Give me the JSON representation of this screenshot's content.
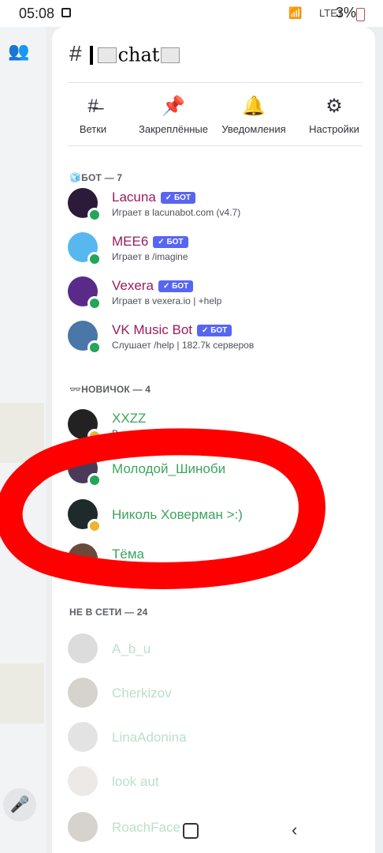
{
  "status_bar": {
    "time": "05:08",
    "network": "LTE1",
    "battery": "3%"
  },
  "channel": {
    "title": "chat"
  },
  "actions": [
    {
      "label": "Ветки",
      "icon": "threads-icon"
    },
    {
      "label": "Закреплённые",
      "icon": "pin-icon"
    },
    {
      "label": "Уведомления",
      "icon": "bell-icon"
    },
    {
      "label": "Настройки",
      "icon": "gear-icon"
    }
  ],
  "sections": {
    "bots": "БОТ — 7",
    "newbie": "НОВИЧОК — 4",
    "offline": "НЕ В СЕТИ — 24"
  },
  "bot_badge": "✓ БОТ",
  "bots": [
    {
      "name": "Lacuna",
      "status": "Играет в lacunabot.com (v4.7)",
      "avatar_color": "#2b1a3a"
    },
    {
      "name": "MEE6",
      "status": "Играет в /imagine",
      "avatar_color": "#57b8f0"
    },
    {
      "name": "Vexera",
      "status": "Играет в vexera.io | +help",
      "avatar_color": "#5a2a8a"
    },
    {
      "name": "VK Music Bot",
      "status": "Слушает /help | 182.7k серверов",
      "avatar_color": "#4a76a8"
    }
  ],
  "newbies": [
    {
      "name": "XXZZ",
      "status": "В отпуске с 13.06 по 24.06",
      "presence": "idle",
      "avatar_color": "#222222"
    },
    {
      "name": "Молодой_Шиноби",
      "status": "",
      "presence": "online",
      "avatar_color": "#4a3a5a"
    },
    {
      "name": "Николь Ховерман >:)",
      "status": "",
      "presence": "idle",
      "avatar_color": "#1f2a2a"
    },
    {
      "name": "Тёма",
      "status": "",
      "presence": "online",
      "avatar_color": "#6a4a3a"
    }
  ],
  "offline": [
    {
      "name": "A_b_u",
      "avatar_color": "#9a9a9a"
    },
    {
      "name": "Cherkizov",
      "avatar_color": "#8a7f72"
    },
    {
      "name": "LinaAdonina",
      "avatar_color": "#b0b0b0"
    },
    {
      "name": "look aut",
      "avatar_color": "#c8c0b8"
    },
    {
      "name": "RoachFace",
      "avatar_color": "#8a8070"
    }
  ],
  "colors": {
    "bot_name": "#9b1b5a",
    "newbie_name": "#3ba55c",
    "offline_name": "#3ba55c",
    "badge": "#5865f2",
    "annotation": "#ff0000"
  }
}
